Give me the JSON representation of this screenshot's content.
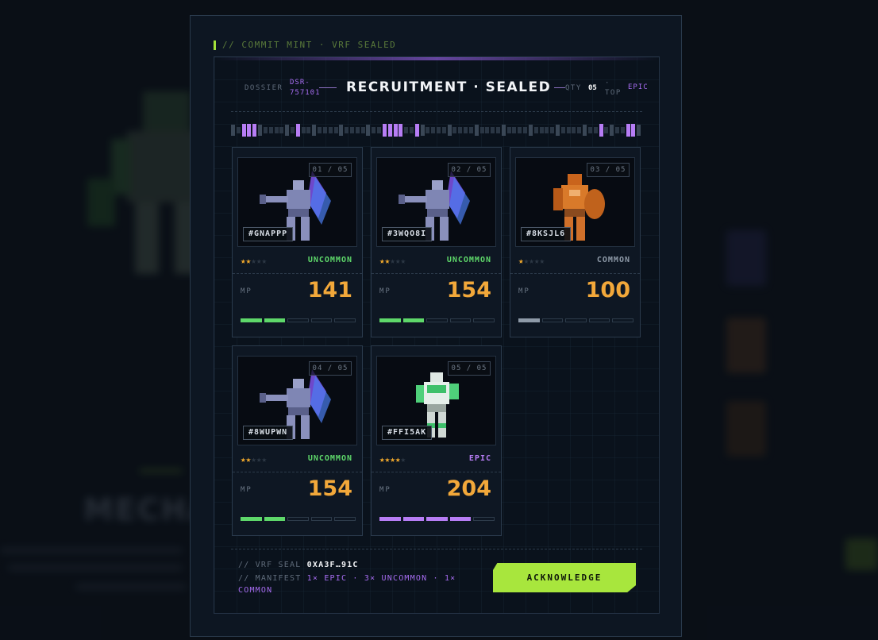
{
  "modal": {
    "tag": "// COMMIT MINT · VRF SEALED",
    "header": {
      "dossier_label": "DOSSIER",
      "dossier_id_line1": "DSR-",
      "dossier_id_line2": "757101",
      "title": "RECRUITMENT · SEALED",
      "qty_label": "QTY",
      "qty_value": "05",
      "qty_sep": "·",
      "top_label": "TOP",
      "top_value": "EPIC"
    },
    "segments": {
      "count": 76,
      "highlighted": [
        2,
        3,
        4,
        12,
        28,
        29,
        30,
        31,
        34,
        68,
        73,
        74
      ]
    },
    "cards": [
      {
        "slot": "01 / 05",
        "id": "#GNAPPP",
        "stars": 2,
        "rarity": "UNCOMMON",
        "mp_label": "MP",
        "mp": "141",
        "pips": 2,
        "mech": "purple-mech"
      },
      {
        "slot": "02 / 05",
        "id": "#3WQO8I",
        "stars": 2,
        "rarity": "UNCOMMON",
        "mp_label": "MP",
        "mp": "154",
        "pips": 2,
        "mech": "purple-mech"
      },
      {
        "slot": "03 / 05",
        "id": "#8KSJL6",
        "stars": 1,
        "rarity": "COMMON",
        "mp_label": "MP",
        "mp": "100",
        "pips": 1,
        "mech": "orange-mech"
      },
      {
        "slot": "04 / 05",
        "id": "#8WUPWN",
        "stars": 2,
        "rarity": "UNCOMMON",
        "mp_label": "MP",
        "mp": "154",
        "pips": 2,
        "mech": "purple-mech"
      },
      {
        "slot": "05 / 05",
        "id": "#FFI5AK",
        "stars": 4,
        "rarity": "EPIC",
        "mp_label": "MP",
        "mp": "204",
        "pips": 4,
        "mech": "green-mech"
      }
    ],
    "footer": {
      "vrf_prefix": "// VRF SEAL",
      "vrf_value": "0XA3F…91C",
      "manifest_prefix": "// MANIFEST",
      "manifest_line1": "1× EPIC · 3× UNCOMMON · 1×",
      "manifest_line2": "COMMON",
      "ack_label": "ACKNOWLEDGE"
    }
  },
  "background": {
    "title": "MECHA"
  },
  "colors": {
    "accent_green": "#a8e63d",
    "uncommon": "#5ed86a",
    "common": "#8e9aa8",
    "epic": "#b77df5",
    "mp_value": "#f2a83a",
    "star": "#f0a82c"
  }
}
